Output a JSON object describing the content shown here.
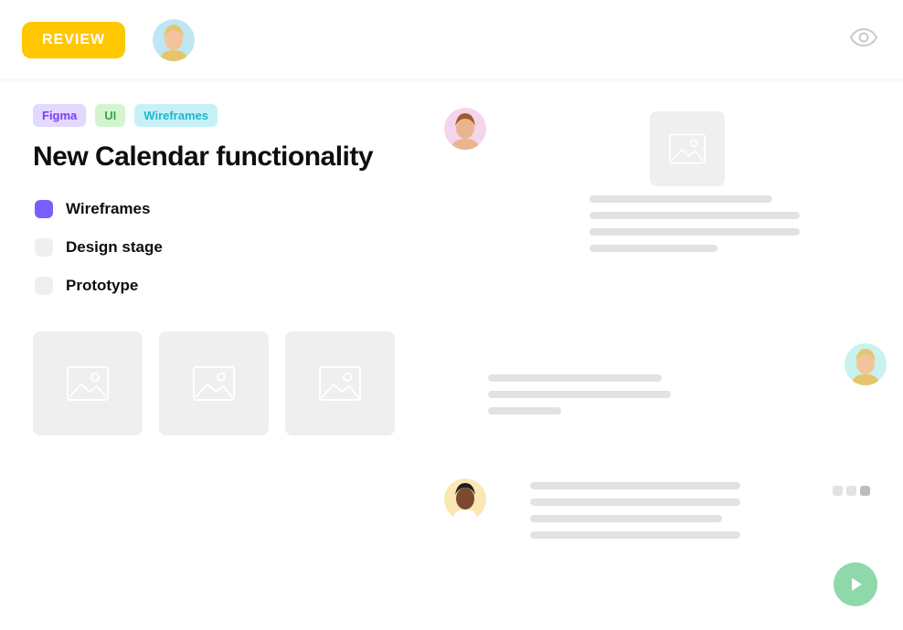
{
  "header": {
    "review_label": "REVIEW",
    "viewer_avatar": {
      "bg": "#BEE6F3",
      "skin": "#F3C49B",
      "hair": "#E6C46B"
    },
    "eye_icon_name": "visibility-icon"
  },
  "tags": [
    {
      "label": "Figma",
      "variant": "figma"
    },
    {
      "label": "UI",
      "variant": "ui"
    },
    {
      "label": "Wireframes",
      "variant": "wf"
    }
  ],
  "title": "New Calendar functionality",
  "checklist": [
    {
      "label": "Wireframes",
      "done": true
    },
    {
      "label": "Design stage",
      "done": false
    },
    {
      "label": "Prototype",
      "done": false
    }
  ],
  "attachments": [
    {
      "kind": "image-placeholder"
    },
    {
      "kind": "image-placeholder"
    },
    {
      "kind": "image-placeholder"
    }
  ],
  "comments": [
    {
      "author_avatar": {
        "bg": "#F3D6EB",
        "skin": "#E9B48E",
        "hair": "#A05A2E"
      },
      "layout": "image-with-lines",
      "line_widths": [
        200,
        230,
        230,
        140
      ],
      "has_image_thumb": true
    },
    {
      "author_avatar": {
        "bg": "#C8F2ED",
        "skin": "#F3C49B",
        "hair": "#E6C46B"
      },
      "avatar_side": "right",
      "layout": "lines-only",
      "line_widths": [
        190,
        200,
        80
      ]
    },
    {
      "author_avatar": {
        "bg": "#FBE7B3",
        "skin": "#7A4A2E",
        "hair": "#1E1E1E"
      },
      "layout": "lines-only",
      "line_widths": [
        230,
        230,
        210,
        230
      ],
      "pager": {
        "count": 3,
        "active_index": 2
      }
    }
  ],
  "colors": {
    "accent_yellow": "#FFC700",
    "fab_green": "#8FD8A9",
    "checklist_done": "#7B5CFF"
  },
  "fab": {
    "icon_name": "play-icon"
  }
}
